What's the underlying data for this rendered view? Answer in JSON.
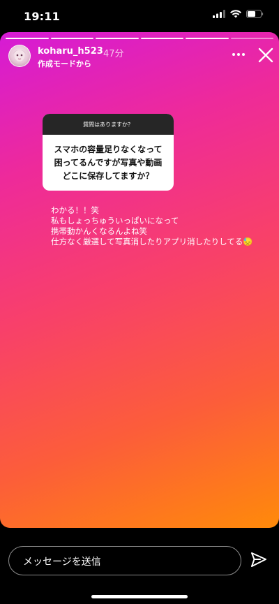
{
  "status_bar": {
    "time": "19:11"
  },
  "story": {
    "progress_total": 6,
    "progress_active": 5,
    "username": "koharu_h523",
    "time_ago": "47分",
    "subtitle": "作成モードから",
    "more_icon": "more-horizontal-icon",
    "close_icon": "close-icon"
  },
  "question_card": {
    "header": "質問はありますか？",
    "lines": [
      "スマホの容量足りなくなって",
      "困ってるんですが写真や動画",
      "どこに保存してますか？"
    ]
  },
  "reply": {
    "lines": [
      "わかる！！笑",
      "私もしょっちゅういっぱいになって",
      "携帯動かんくなるんよね笑",
      "仕方なく厳選して写真消したりアプリ消したりしてる😓"
    ]
  },
  "message_bar": {
    "placeholder": "メッセージを送信",
    "send_icon": "send-icon"
  },
  "colors": {
    "gradient_start": "#d51bd6",
    "gradient_end": "#ff8a0a"
  }
}
